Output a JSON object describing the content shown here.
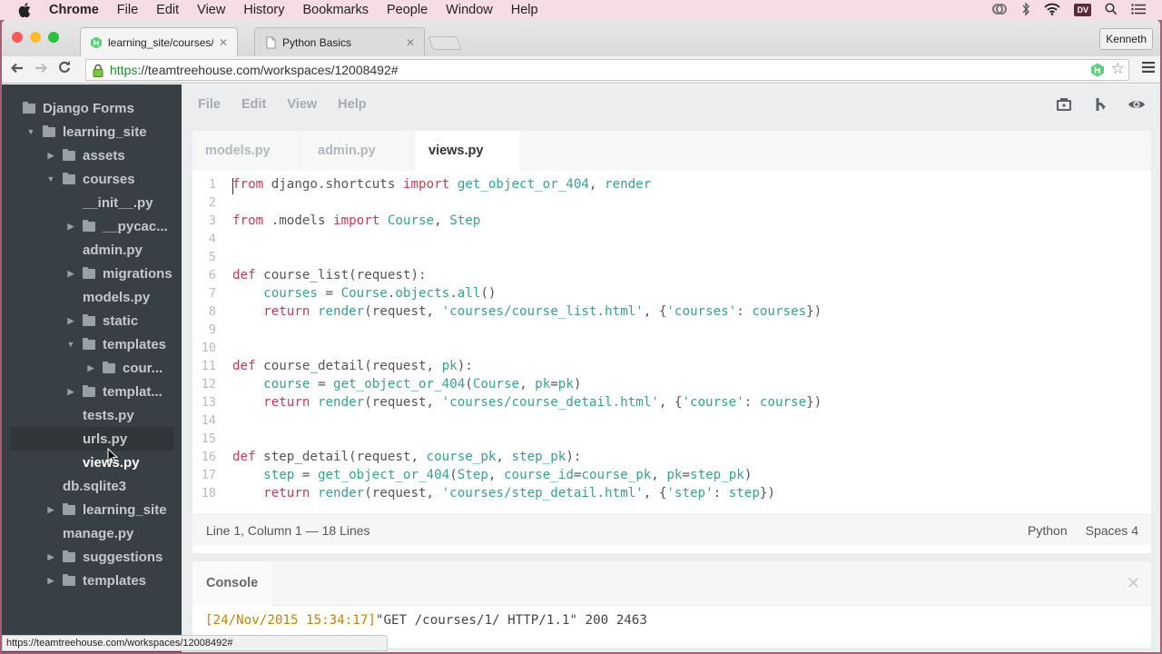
{
  "menubar": {
    "app": "Chrome",
    "items": [
      "File",
      "Edit",
      "View",
      "History",
      "Bookmarks",
      "People",
      "Window",
      "Help"
    ],
    "status_icons": [
      "creative-cloud-icon",
      "bluetooth-icon",
      "wifi-icon",
      "dv-icon",
      "spotlight-search-icon",
      "notification-center-icon"
    ],
    "dv_label": "DV"
  },
  "browser": {
    "tabs": [
      {
        "title": "learning_site/courses/views.py",
        "icon": "treehouse-icon",
        "active": true
      },
      {
        "title": "Python Basics",
        "icon": "page-icon",
        "active": false
      }
    ],
    "profile": "Kenneth",
    "url_scheme": "https",
    "url_rest": "://teamtreehouse.com/workspaces/12008492#",
    "hover_url": "https://teamtreehouse.com/workspaces/12008492#"
  },
  "sidebar": {
    "items": [
      {
        "label": "Django Forms",
        "type": "folder",
        "depth": 0,
        "arrow": ""
      },
      {
        "label": "learning_site",
        "type": "folder",
        "depth": 1,
        "arrow": "down"
      },
      {
        "label": "assets",
        "type": "folder",
        "depth": 2,
        "arrow": "right"
      },
      {
        "label": "courses",
        "type": "folder",
        "depth": 2,
        "arrow": "down"
      },
      {
        "label": "__init__.py",
        "type": "file",
        "depth": 3,
        "arrow": ""
      },
      {
        "label": "__pycac...",
        "type": "folder",
        "depth": 3,
        "arrow": "right"
      },
      {
        "label": "admin.py",
        "type": "file",
        "depth": 3,
        "arrow": ""
      },
      {
        "label": "migrations",
        "type": "folder",
        "depth": 3,
        "arrow": "right"
      },
      {
        "label": "models.py",
        "type": "file",
        "depth": 3,
        "arrow": ""
      },
      {
        "label": "static",
        "type": "folder",
        "depth": 3,
        "arrow": "right"
      },
      {
        "label": "templates",
        "type": "folder",
        "depth": 3,
        "arrow": "down"
      },
      {
        "label": "cour...",
        "type": "folder",
        "depth": 4,
        "arrow": "right"
      },
      {
        "label": "templat...",
        "type": "folder",
        "depth": 3,
        "arrow": "right"
      },
      {
        "label": "tests.py",
        "type": "file",
        "depth": 3,
        "arrow": ""
      },
      {
        "label": "urls.py",
        "type": "file",
        "depth": 3,
        "arrow": "",
        "hovered": true
      },
      {
        "label": "views.py",
        "type": "file",
        "depth": 3,
        "arrow": "",
        "open": true
      },
      {
        "label": "db.sqlite3",
        "type": "file",
        "depth": 2,
        "arrow": ""
      },
      {
        "label": "learning_site",
        "type": "folder",
        "depth": 2,
        "arrow": "right"
      },
      {
        "label": "manage.py",
        "type": "file",
        "depth": 2,
        "arrow": ""
      },
      {
        "label": "suggestions",
        "type": "folder",
        "depth": 2,
        "arrow": "right"
      },
      {
        "label": "templates",
        "type": "folder",
        "depth": 2,
        "arrow": "right"
      }
    ]
  },
  "workspace_menu": {
    "items": [
      "File",
      "Edit",
      "View",
      "Help"
    ],
    "tools": [
      "snapshot-icon",
      "fork-icon",
      "preview-eye-icon"
    ]
  },
  "editor": {
    "tabs": [
      "models.py",
      "admin.py",
      "views.py"
    ],
    "active_tab": "views.py",
    "lines": [
      [
        [
          "kw",
          "from"
        ],
        [
          "pl",
          " django.shortcuts "
        ],
        [
          "kw",
          "import"
        ],
        [
          "id",
          " get_object_or_404"
        ],
        [
          "pl",
          ", "
        ],
        [
          "id",
          "render"
        ]
      ],
      [],
      [
        [
          "kw",
          "from"
        ],
        [
          "pl",
          " .models "
        ],
        [
          "kw",
          "import"
        ],
        [
          "id",
          " Course"
        ],
        [
          "pl",
          ", "
        ],
        [
          "id",
          "Step"
        ]
      ],
      [],
      [],
      [
        [
          "kw",
          "def"
        ],
        [
          "pl",
          " course_list(request):"
        ]
      ],
      [
        [
          "pl",
          "    "
        ],
        [
          "id",
          "courses"
        ],
        [
          "pl",
          " = "
        ],
        [
          "id",
          "Course"
        ],
        [
          "pl",
          "."
        ],
        [
          "id",
          "objects"
        ],
        [
          "pl",
          "."
        ],
        [
          "id",
          "all"
        ],
        [
          "pl",
          "()"
        ]
      ],
      [
        [
          "pl",
          "    "
        ],
        [
          "kw",
          "return"
        ],
        [
          "id",
          " render"
        ],
        [
          "pl",
          "(request, "
        ],
        [
          "st",
          "'courses/course_list.html'"
        ],
        [
          "pl",
          ", {"
        ],
        [
          "st",
          "'courses'"
        ],
        [
          "pl",
          ": "
        ],
        [
          "id",
          "courses"
        ],
        [
          "pl",
          "})"
        ]
      ],
      [],
      [],
      [
        [
          "kw",
          "def"
        ],
        [
          "pl",
          " course_detail(request, "
        ],
        [
          "id",
          "pk"
        ],
        [
          "pl",
          "):"
        ]
      ],
      [
        [
          "pl",
          "    "
        ],
        [
          "id",
          "course"
        ],
        [
          "pl",
          " = "
        ],
        [
          "id",
          "get_object_or_404"
        ],
        [
          "pl",
          "("
        ],
        [
          "id",
          "Course"
        ],
        [
          "pl",
          ", "
        ],
        [
          "id",
          "pk"
        ],
        [
          "pl",
          "="
        ],
        [
          "id",
          "pk"
        ],
        [
          "pl",
          ")"
        ]
      ],
      [
        [
          "pl",
          "    "
        ],
        [
          "kw",
          "return"
        ],
        [
          "id",
          " render"
        ],
        [
          "pl",
          "(request, "
        ],
        [
          "st",
          "'courses/course_detail.html'"
        ],
        [
          "pl",
          ", {"
        ],
        [
          "st",
          "'course'"
        ],
        [
          "pl",
          ": "
        ],
        [
          "id",
          "course"
        ],
        [
          "pl",
          "})"
        ]
      ],
      [],
      [],
      [
        [
          "kw",
          "def"
        ],
        [
          "pl",
          " step_detail(request, "
        ],
        [
          "id",
          "course_pk"
        ],
        [
          "pl",
          ", "
        ],
        [
          "id",
          "step_pk"
        ],
        [
          "pl",
          "):"
        ]
      ],
      [
        [
          "pl",
          "    "
        ],
        [
          "id",
          "step"
        ],
        [
          "pl",
          " = "
        ],
        [
          "id",
          "get_object_or_404"
        ],
        [
          "pl",
          "("
        ],
        [
          "id",
          "Step"
        ],
        [
          "pl",
          ", "
        ],
        [
          "id",
          "course_id"
        ],
        [
          "pl",
          "="
        ],
        [
          "id",
          "course_pk"
        ],
        [
          "pl",
          ", "
        ],
        [
          "id",
          "pk"
        ],
        [
          "pl",
          "="
        ],
        [
          "id",
          "step_pk"
        ],
        [
          "pl",
          ")"
        ]
      ],
      [
        [
          "pl",
          "    "
        ],
        [
          "kw",
          "return"
        ],
        [
          "id",
          " render"
        ],
        [
          "pl",
          "(request, "
        ],
        [
          "st",
          "'courses/step_detail.html'"
        ],
        [
          "pl",
          ", {"
        ],
        [
          "st",
          "'step'"
        ],
        [
          "pl",
          ": "
        ],
        [
          "id",
          "step"
        ],
        [
          "pl",
          "})"
        ]
      ]
    ]
  },
  "statusbar": {
    "position": "Line 1, Column 1 — 18 Lines",
    "language": "Python",
    "indent": "Spaces",
    "indent_size": "4"
  },
  "console": {
    "title": "Console",
    "timestamp": "[24/Nov/2015 15:34:17]",
    "message": "\"GET /courses/1/ HTTP/1.1\" 200 2463"
  }
}
